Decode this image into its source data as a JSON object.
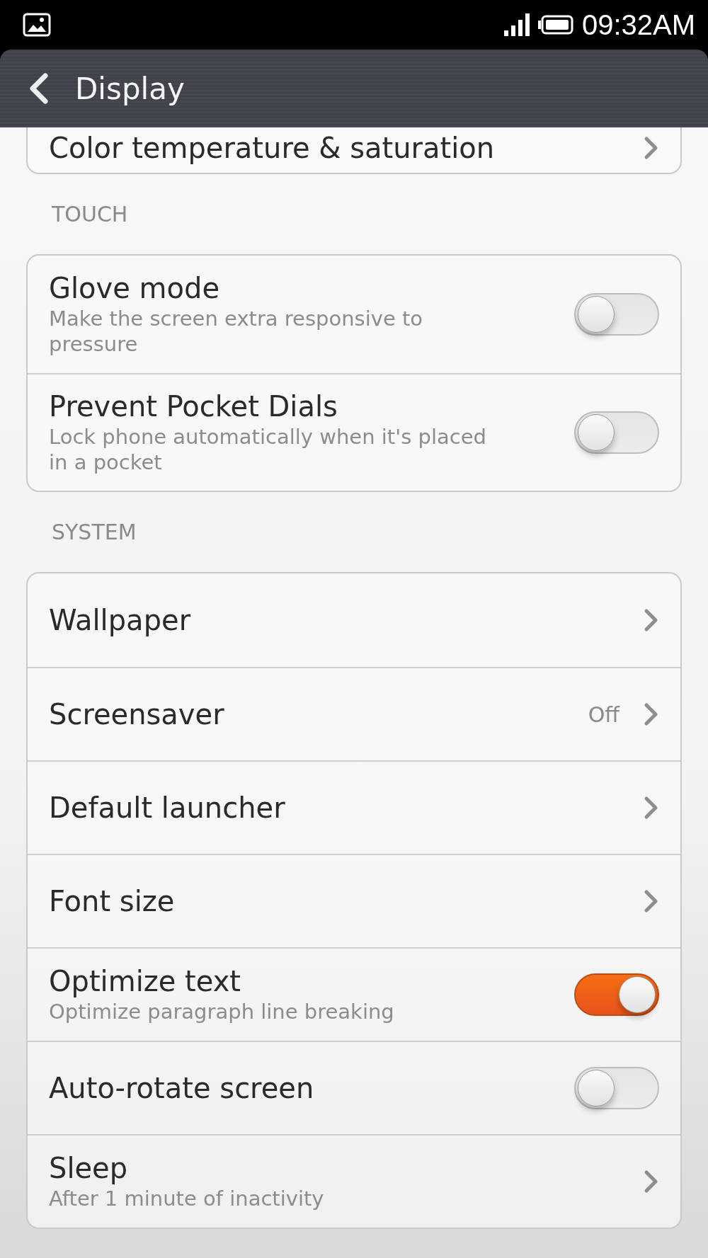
{
  "status_bar": {
    "time": "09:32AM"
  },
  "header": {
    "title": "Display"
  },
  "sections": [
    {
      "items": [
        {
          "kind": "link",
          "title": "Color temperature & saturation"
        }
      ]
    },
    {
      "label": "TOUCH",
      "items": [
        {
          "kind": "toggle",
          "title": "Glove mode",
          "subtitle": "Make the screen extra responsive to pressure",
          "on": false
        },
        {
          "kind": "toggle",
          "title": "Prevent Pocket Dials",
          "subtitle": "Lock phone automatically when it's placed in a pocket",
          "on": false
        }
      ]
    },
    {
      "label": "SYSTEM",
      "items": [
        {
          "kind": "link",
          "title": "Wallpaper"
        },
        {
          "kind": "link",
          "title": "Screensaver",
          "value": "Off"
        },
        {
          "kind": "link",
          "title": "Default launcher"
        },
        {
          "kind": "link",
          "title": "Font size"
        },
        {
          "kind": "toggle",
          "title": "Optimize text",
          "subtitle": "Optimize paragraph line breaking",
          "on": true
        },
        {
          "kind": "toggle",
          "title": "Auto-rotate screen",
          "on": false
        },
        {
          "kind": "link",
          "title": "Sleep",
          "subtitle": "After 1 minute of inactivity"
        }
      ]
    }
  ]
}
